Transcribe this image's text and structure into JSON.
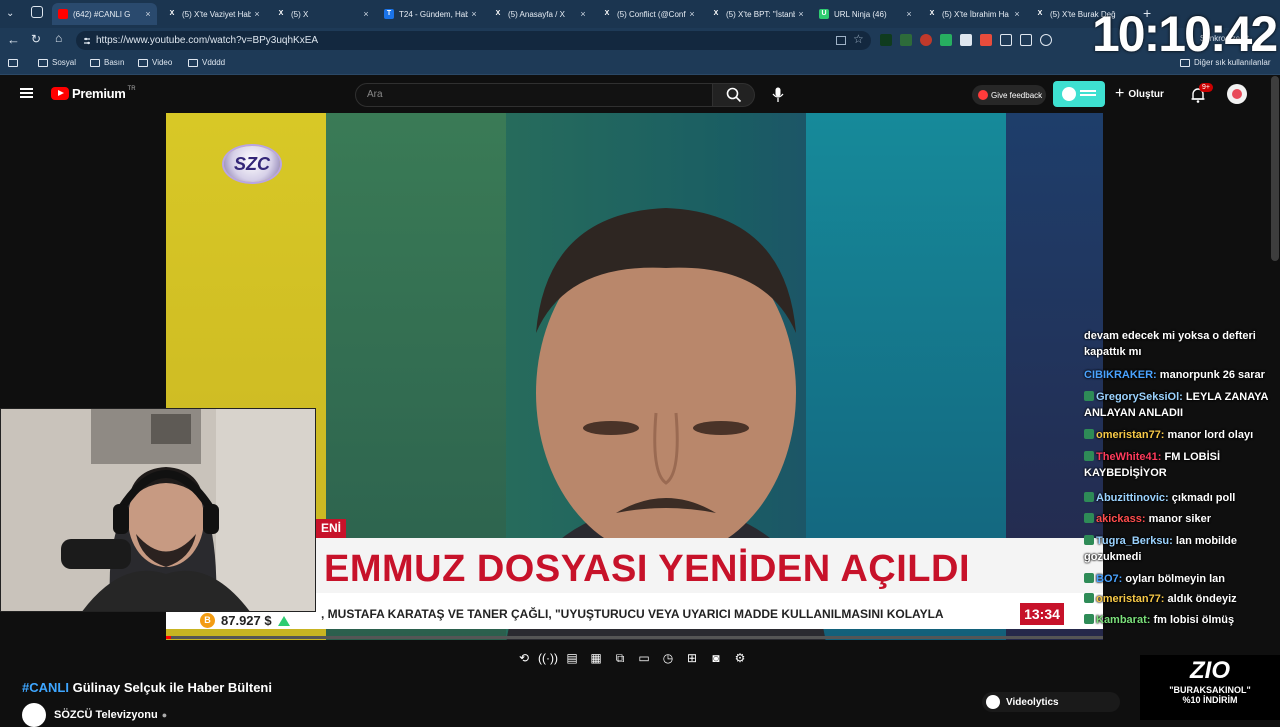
{
  "browser": {
    "tabs": [
      {
        "label": "(642) #CANLI G",
        "icon": "youtube-icon",
        "active": true
      },
      {
        "label": "(5) X'te Vaziyet Hab",
        "icon": "x-icon"
      },
      {
        "label": "(5) X",
        "icon": "x-icon"
      },
      {
        "label": "T24 - Gündem, Hab",
        "icon": "t24-icon"
      },
      {
        "label": "(5) Anasayfa / X",
        "icon": "x-icon"
      },
      {
        "label": "(5) Conflict (@Confl",
        "icon": "x-icon"
      },
      {
        "label": "(5) X'te BPT: \"İstanb",
        "icon": "x-icon"
      },
      {
        "label": "URL Ninja (46)",
        "icon": "url-ninja-icon"
      },
      {
        "label": "(5) X'te İbrahim Ha",
        "icon": "x-icon"
      },
      {
        "label": "(5) X'te Burak Değ",
        "icon": "x-icon"
      }
    ],
    "url": "https://www.youtube.com/watch?v=BPy3uqhKxEA",
    "bookmarks": [
      "Sosyal",
      "Basın",
      "Video",
      "Vdddd"
    ],
    "other_bookmarks": "Diğer sık kullanılanlar",
    "clock": "10:10:42",
    "sync_label": "Senkronize et"
  },
  "youtube": {
    "logo": "Premium",
    "logo_superscript": "TR",
    "search_placeholder": "Ara",
    "feedback_label": "Give feedback",
    "create_label": "Oluştur",
    "notifications_badge": "9+"
  },
  "video": {
    "channel_logo": "SZC",
    "breaking_tag": "ENİ",
    "headline": "EMMUZ DOSYASI YENİDEN AÇILDI",
    "ticker": ", MUSTAFA KARATAŞ VE TANER ÇAĞLI, \"UYUŞTURUCU VEYA UYARICI MADDE KULLANILMASINI KOLAYLA",
    "ticker_time": "13:34",
    "btc_price": "87.927 $",
    "progress_fraction": 0.005
  },
  "chat": [
    {
      "user": "",
      "text": "devam edecek mi yoksa o defteri kapattık mı",
      "color": "#ffffff"
    },
    {
      "user": "CIBIKRAKER:",
      "text": "manorpunk 26 sarar",
      "color": "#4aa3ff"
    },
    {
      "user": "GregorySeksiOl:",
      "text": "LEYLA ZANAYA ANLAYAN ANLADII",
      "color": "#9bd3ff"
    },
    {
      "user": "omeristan77:",
      "text": "manor lord olayı",
      "color": "#f7c948"
    },
    {
      "user": "TheWhite41:",
      "text": "FM LOBİSİ KAYBEDİŞİYOR",
      "color": "#ff3b5c"
    },
    {
      "user": "Abuzittinovic:",
      "text": "çıkmadı poll",
      "color": "#9bd3ff"
    },
    {
      "user": "akickass:",
      "text": "manor siker",
      "color": "#ff4d4d"
    },
    {
      "user": "Tugra_Berksu:",
      "text": "lan mobilde gozukmedi",
      "color": "#9bd3ff"
    },
    {
      "user": "BO7:",
      "text": "oyları bölmeyin lan",
      "color": "#4aa3ff"
    },
    {
      "user": "omeristan77:",
      "text": "aldık öndeyiz",
      "color": "#f7c948"
    },
    {
      "user": "Kambarat:",
      "text": "fm lobisi ölmüş",
      "color": "#7be07b"
    }
  ],
  "below": {
    "title_tag": "#CANLI",
    "title": "Gülinay Selçuk ile Haber Bülteni",
    "channel": "SÖZCÜ Televizyonu",
    "videolytics": "Videolytics",
    "promo_brand": "ZIO",
    "promo_line1": "\"BURAKSAKINOL\"",
    "promo_line2": "%10 İNDİRİM"
  }
}
